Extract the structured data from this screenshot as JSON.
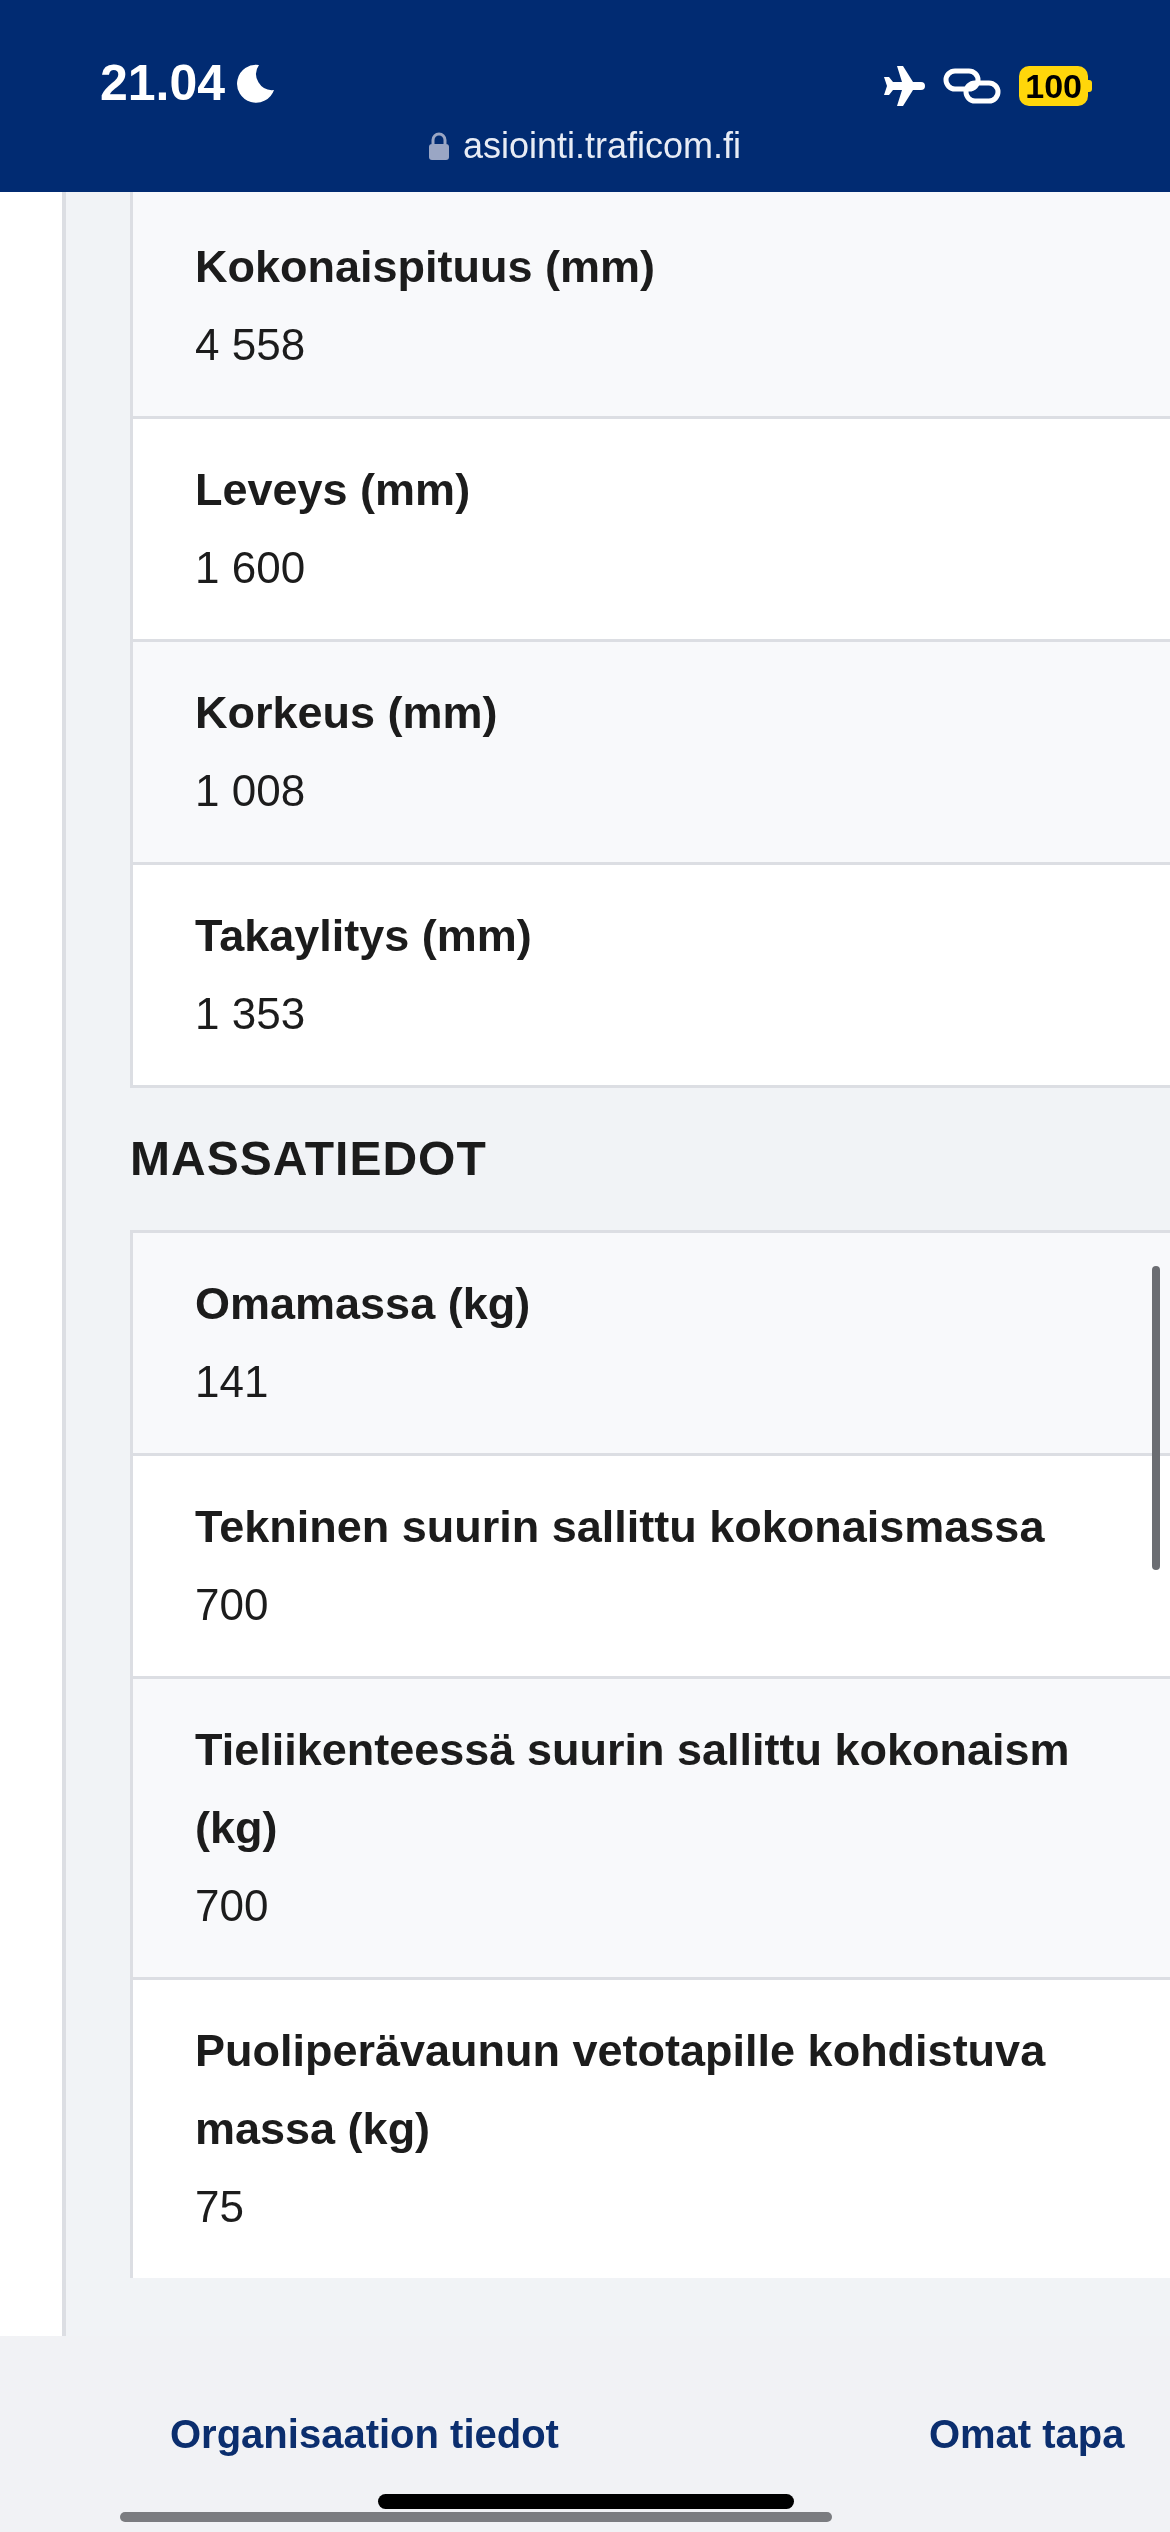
{
  "status_bar": {
    "time": "21.04",
    "battery": "100"
  },
  "address_bar": {
    "url": "asiointi.traficom.fi"
  },
  "dimensions_table": {
    "rows": [
      {
        "label_lines": [
          "Kokonaispituus (mm)"
        ],
        "value": "4 558"
      },
      {
        "label_lines": [
          "Leveys (mm)"
        ],
        "value": "1 600"
      },
      {
        "label_lines": [
          "Korkeus (mm)"
        ],
        "value": "1 008"
      },
      {
        "label_lines": [
          "Takaylitys (mm)"
        ],
        "value": "1 353"
      }
    ]
  },
  "mass_section": {
    "heading": "MASSATIEDOT",
    "rows": [
      {
        "label_lines": [
          "Omamassa (kg)"
        ],
        "value": "141"
      },
      {
        "label_lines": [
          "Tekninen suurin sallittu kokonaismassa"
        ],
        "value": "700"
      },
      {
        "label_lines": [
          "Tieliikenteessä suurin sallittu kokonaism",
          "(kg)"
        ],
        "value": "700"
      },
      {
        "label_lines": [
          "Puoliperävaunun vetotapille kohdistuva",
          "massa (kg)"
        ],
        "value": "75"
      }
    ]
  },
  "bottom_nav": {
    "links": [
      "Organisaation tiedot",
      "Omat tapa"
    ]
  }
}
